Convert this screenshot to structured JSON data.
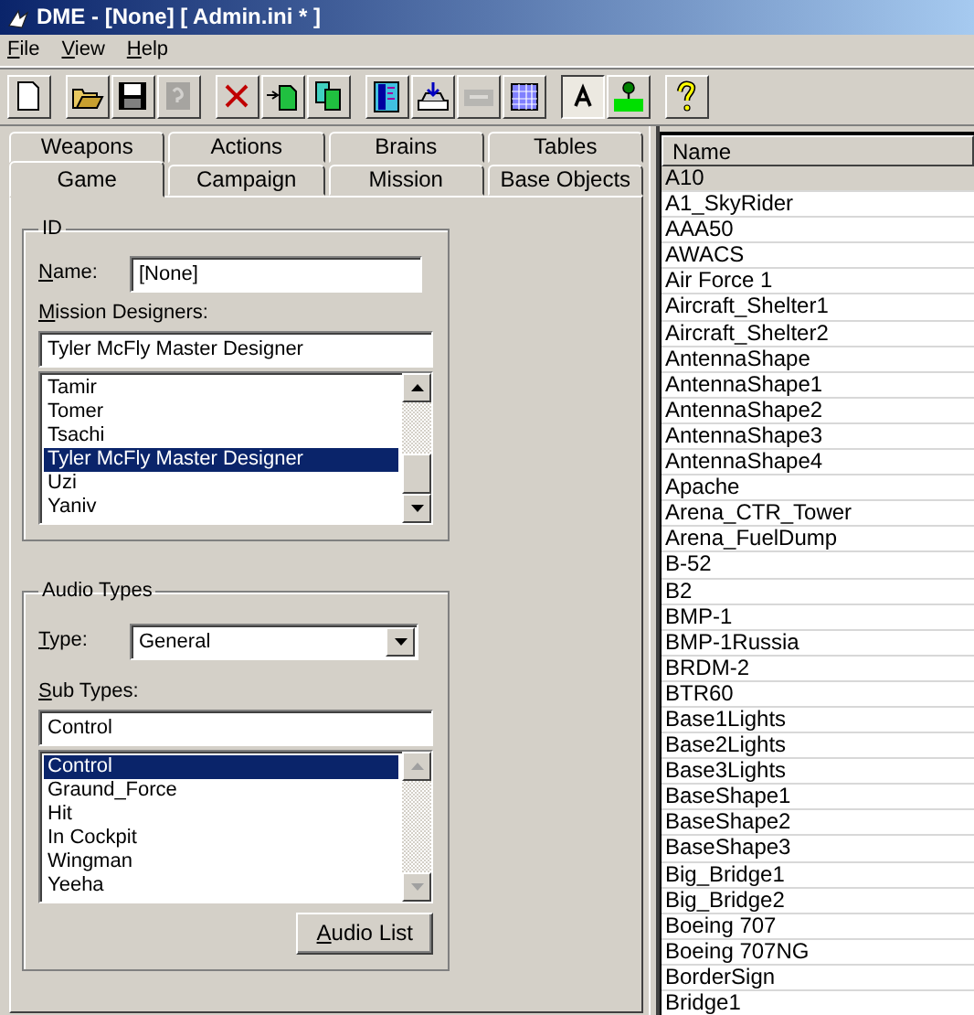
{
  "window": {
    "title": "DME - [None] [ Admin.ini * ]"
  },
  "menu": [
    "File",
    "View",
    "Help"
  ],
  "toolbar": [
    {
      "buttons": [
        {
          "pressed": false,
          "disabled": false
        }
      ]
    },
    {
      "buttons": [
        {
          "pressed": false,
          "disabled": false
        },
        {
          "pressed": false,
          "disabled": false
        },
        {
          "pressed": false,
          "disabled": true
        }
      ]
    },
    {
      "buttons": [
        {
          "pressed": false,
          "disabled": false
        },
        {
          "pressed": false,
          "disabled": false
        },
        {
          "pressed": false,
          "disabled": false
        }
      ]
    },
    {
      "buttons": [
        {
          "pressed": false,
          "disabled": false
        },
        {
          "pressed": false,
          "disabled": false
        },
        {
          "pressed": false,
          "disabled": true
        },
        {
          "pressed": false,
          "disabled": false
        }
      ]
    },
    {
      "buttons": [
        {
          "pressed": true,
          "disabled": false
        },
        {
          "pressed": false,
          "disabled": false
        }
      ]
    },
    {
      "buttons": [
        {
          "pressed": false,
          "disabled": false
        }
      ]
    }
  ],
  "tabs_back": [
    {
      "label": "Weapons",
      "selected": false
    },
    {
      "label": "Actions",
      "selected": false
    },
    {
      "label": "Brains",
      "selected": false
    },
    {
      "label": "Tables",
      "selected": false
    }
  ],
  "tabs_front": [
    {
      "label": "Game",
      "selected": true
    },
    {
      "label": "Campaign",
      "selected": false
    },
    {
      "label": "Mission",
      "selected": false
    },
    {
      "label": "Base Objects",
      "selected": false
    }
  ],
  "id_group": {
    "title": "ID",
    "name_label": "Name:",
    "name_value": "[None]",
    "designers_label": "Mission Designers:",
    "designers_value": "Tyler McFly Master Designer",
    "designers": [
      {
        "label": "Tamir",
        "selected": false
      },
      {
        "label": "Tomer",
        "selected": false
      },
      {
        "label": "Tsachi",
        "selected": false
      },
      {
        "label": "Tyler McFly Master Designer",
        "selected": true
      },
      {
        "label": "Uzi",
        "selected": false
      },
      {
        "label": "Yaniv",
        "selected": false
      }
    ],
    "scrollbar_disabled": false
  },
  "audio_group": {
    "title": "Audio Types",
    "type_label": "Type:",
    "type_value": "General",
    "subtypes_label": "Sub Types:",
    "subtypes_value": "Control",
    "subtypes": [
      {
        "label": "Control",
        "selected": true
      },
      {
        "label": "Graund_Force",
        "selected": false
      },
      {
        "label": "Hit",
        "selected": false
      },
      {
        "label": "In Cockpit",
        "selected": false
      },
      {
        "label": "Wingman",
        "selected": false
      },
      {
        "label": "Yeeha",
        "selected": false
      }
    ],
    "scrollbar_disabled": true,
    "button": "Audio List"
  },
  "objects": {
    "column": "Name",
    "rows": [
      {
        "name": "A10",
        "selected": true
      },
      {
        "name": "A1_SkyRider",
        "selected": false
      },
      {
        "name": "AAA50",
        "selected": false
      },
      {
        "name": "AWACS",
        "selected": false
      },
      {
        "name": "Air Force 1",
        "selected": false
      },
      {
        "name": "Aircraft_Shelter1",
        "selected": false
      },
      {
        "name": "Aircraft_Shelter2",
        "selected": false
      },
      {
        "name": "AntennaShape",
        "selected": false
      },
      {
        "name": "AntennaShape1",
        "selected": false
      },
      {
        "name": "AntennaShape2",
        "selected": false
      },
      {
        "name": "AntennaShape3",
        "selected": false
      },
      {
        "name": "AntennaShape4",
        "selected": false
      },
      {
        "name": "Apache",
        "selected": false
      },
      {
        "name": "Arena_CTR_Tower",
        "selected": false
      },
      {
        "name": "Arena_FuelDump",
        "selected": false
      },
      {
        "name": "B-52",
        "selected": false
      },
      {
        "name": "B2",
        "selected": false
      },
      {
        "name": "BMP-1",
        "selected": false
      },
      {
        "name": "BMP-1Russia",
        "selected": false
      },
      {
        "name": "BRDM-2",
        "selected": false
      },
      {
        "name": "BTR60",
        "selected": false
      },
      {
        "name": "Base1Lights",
        "selected": false
      },
      {
        "name": "Base2Lights",
        "selected": false
      },
      {
        "name": "Base3Lights",
        "selected": false
      },
      {
        "name": "BaseShape1",
        "selected": false
      },
      {
        "name": "BaseShape2",
        "selected": false
      },
      {
        "name": "BaseShape3",
        "selected": false
      },
      {
        "name": "Big_Bridge1",
        "selected": false
      },
      {
        "name": "Big_Bridge2",
        "selected": false
      },
      {
        "name": "Boeing 707",
        "selected": false
      },
      {
        "name": "Boeing 707NG",
        "selected": false
      },
      {
        "name": "BorderSign",
        "selected": false
      },
      {
        "name": "Bridge1",
        "selected": false
      }
    ]
  }
}
